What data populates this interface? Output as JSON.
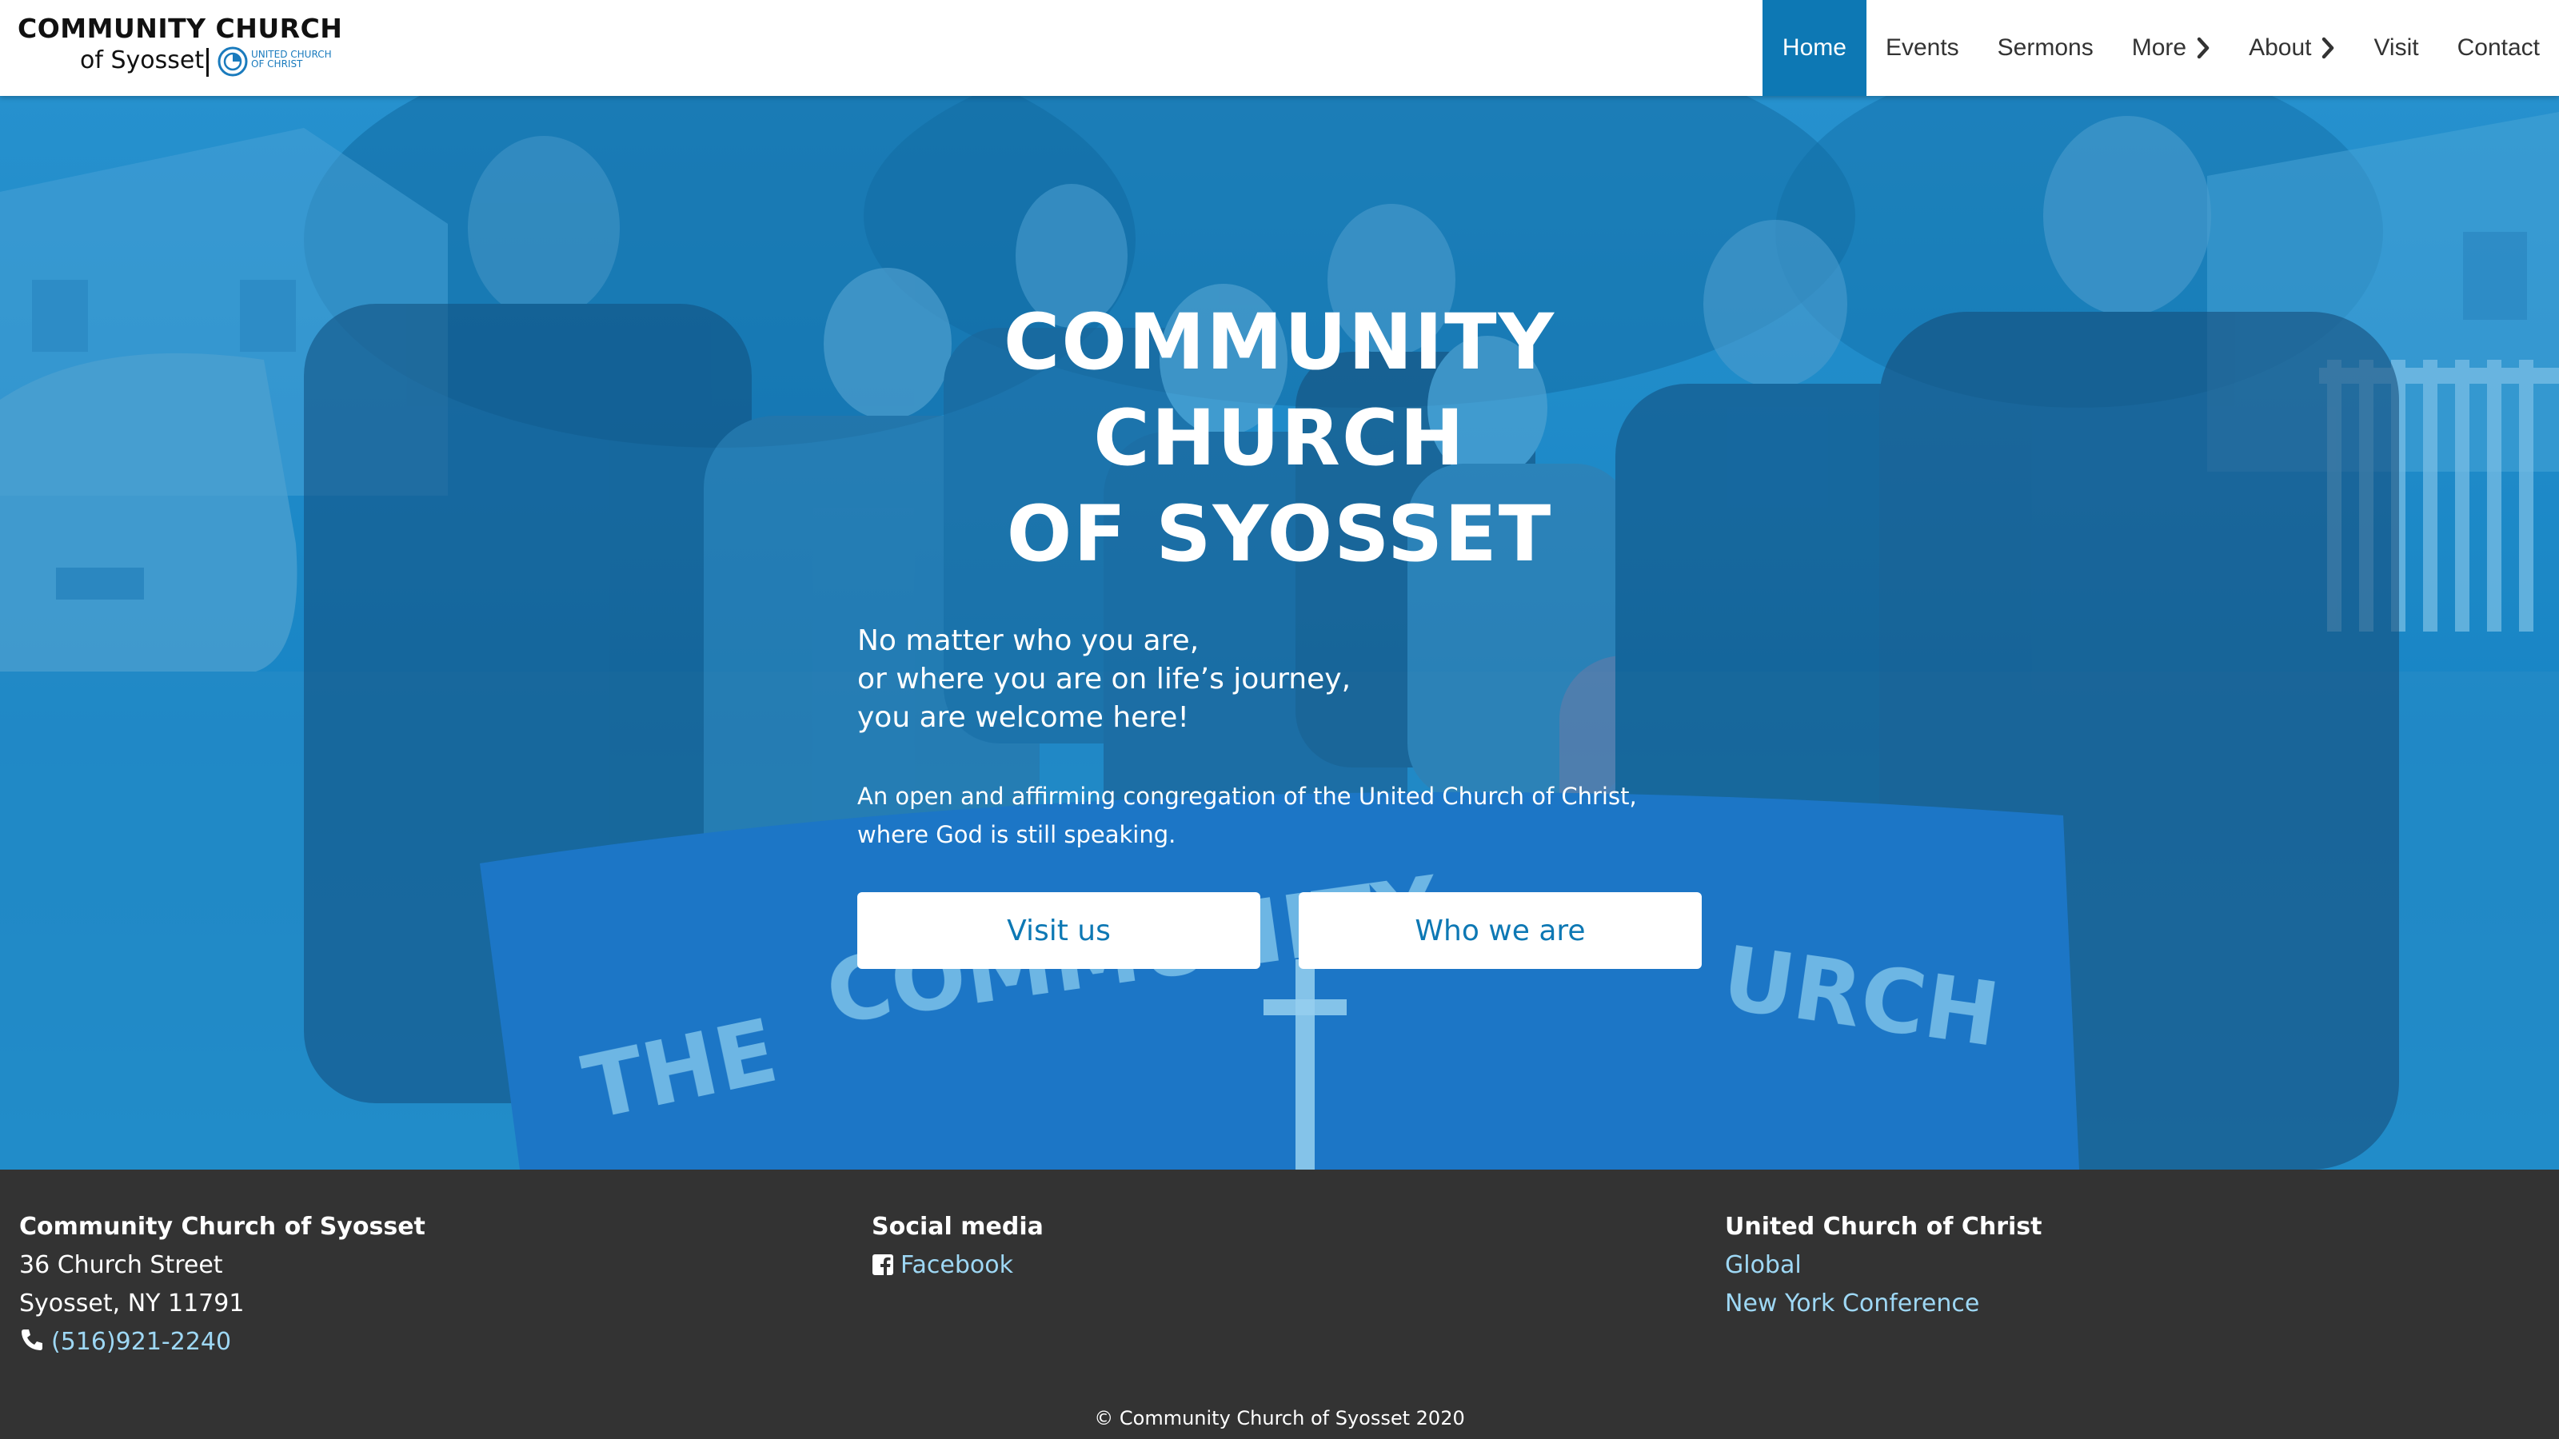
{
  "header": {
    "logo_line1": "COMMUNITY CHURCH",
    "logo_line2": "of Syosset",
    "ucc_line1": "UNITED CHURCH",
    "ucc_line2": "OF CHRIST"
  },
  "nav": {
    "items": [
      {
        "label": "Home",
        "active": true
      },
      {
        "label": "Events"
      },
      {
        "label": "Sermons"
      },
      {
        "label": "More",
        "icon": "chevron-right-icon"
      },
      {
        "label": "About",
        "icon": "chevron-right-icon"
      },
      {
        "label": "Visit"
      },
      {
        "label": "Contact"
      }
    ]
  },
  "hero": {
    "title_line1": "COMMUNITY",
    "title_line2": "CHURCH",
    "title_line3": "OF SYOSSET",
    "tag_line1": "No matter who you are,",
    "tag_line2": "or where you are on life’s journey,",
    "tag_line3": "you are welcome here!",
    "desc_line1": "An open and affirming congregation of the United Church of Christ,",
    "desc_line2": "where God is still speaking.",
    "banner_text": "THE COMMUNITY CHURCH",
    "buttons": {
      "visit": "Visit us",
      "who": "Who we are"
    }
  },
  "footer": {
    "col1": {
      "heading": "Community Church of Syosset",
      "street": "36 Church Street",
      "city": "Syosset, NY 11791",
      "phone": "(516)921-2240",
      "phone_icon": "phone-icon"
    },
    "col2": {
      "heading": "Social media",
      "facebook": "Facebook",
      "facebook_icon": "facebook-icon"
    },
    "col3": {
      "heading": "United Church of Christ",
      "global": "Global",
      "ny": "New York Conference"
    },
    "copyright": "© Community Church of Syosset 2020"
  },
  "colors": {
    "accent": "#0d78b4",
    "hero_overlay": "#1a8ccc",
    "footer_bg": "#333333",
    "link": "#9ed8f5"
  }
}
